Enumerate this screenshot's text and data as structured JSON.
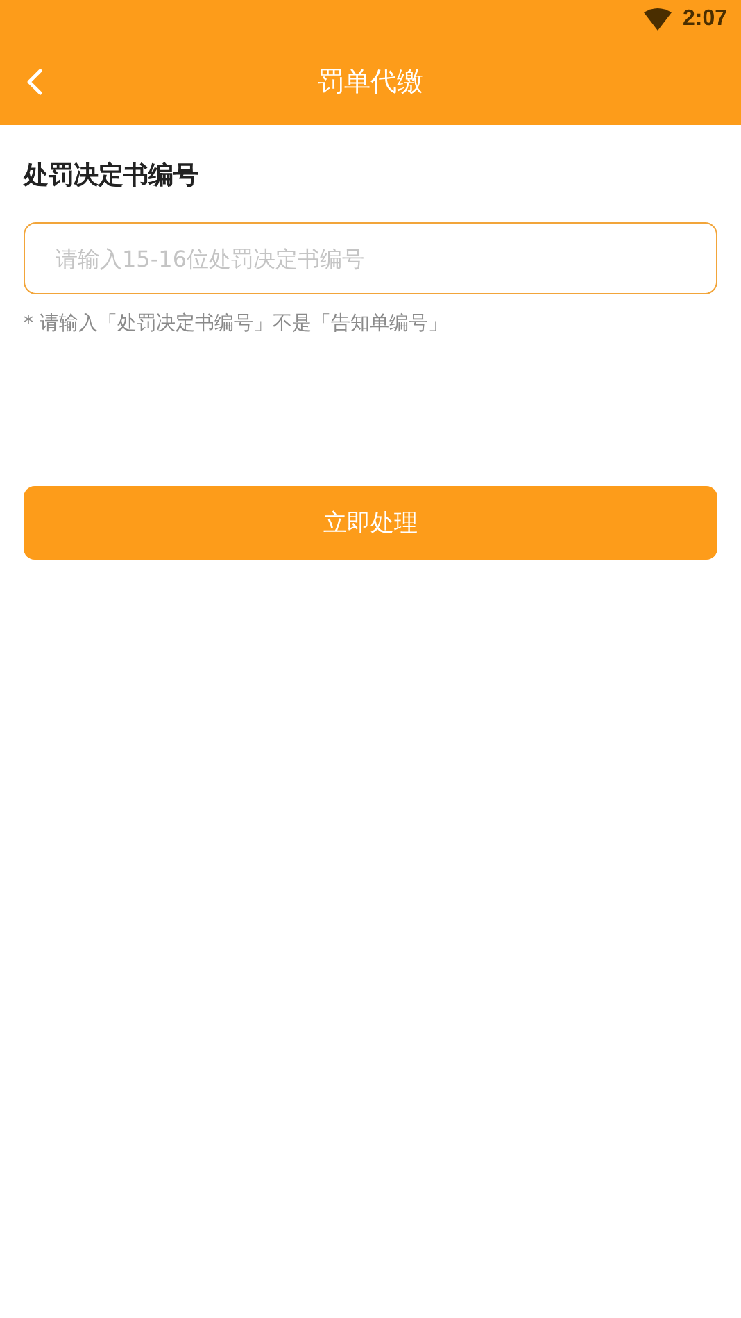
{
  "status_bar": {
    "time": "2:07"
  },
  "header": {
    "title": "罚单代缴"
  },
  "form": {
    "label": "处罚决定书编号",
    "input": {
      "placeholder": "请输入15-16位处罚决定书编号"
    },
    "hint": "* 请输入「处罚决定书编号」不是「告知单编号」"
  },
  "submit_button": {
    "label": "立即处理"
  }
}
